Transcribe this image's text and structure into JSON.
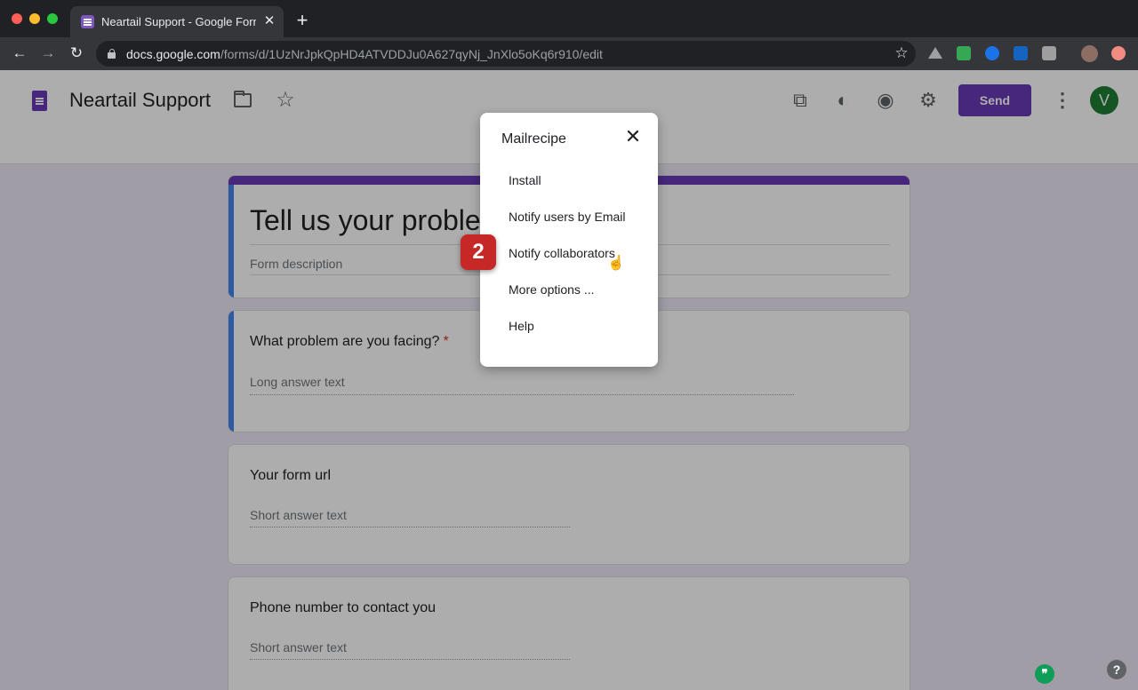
{
  "browser": {
    "tab_title": "Neartail Support - Google Form",
    "tab_close_icon": "close-icon",
    "new_tab_icon": "plus-icon",
    "url_host": "docs.google.com",
    "url_path": "/forms/d/1UzNrJpkQpHD4ATVDDJu0A627qyNj_JnXlo5oKq6r910/edit"
  },
  "appbar": {
    "doc_title": "Neartail Support",
    "send_label": "Send",
    "avatar_letter": "V"
  },
  "form": {
    "title": "Tell us your proble",
    "description_placeholder": "Form description",
    "questions": [
      {
        "title": "What problem are you facing?",
        "required_mark": "*",
        "answer_placeholder": "Long answer text"
      },
      {
        "title": "Your form url",
        "answer_placeholder": "Short answer text"
      },
      {
        "title": "Phone number to contact you",
        "answer_placeholder": "Short answer text"
      }
    ]
  },
  "dialog": {
    "title": "Mailrecipe",
    "items": [
      {
        "label": "Install"
      },
      {
        "label": "Notify users by Email"
      },
      {
        "label": "Notify collaborators"
      },
      {
        "label": "More options ..."
      },
      {
        "label": "Help"
      }
    ]
  },
  "annotation": {
    "step_number": "2"
  },
  "colors": {
    "brand": "#673ab7",
    "accent_blue": "#4285f4",
    "badge_red": "#c62828",
    "avatar_green": "#1e7e34"
  }
}
